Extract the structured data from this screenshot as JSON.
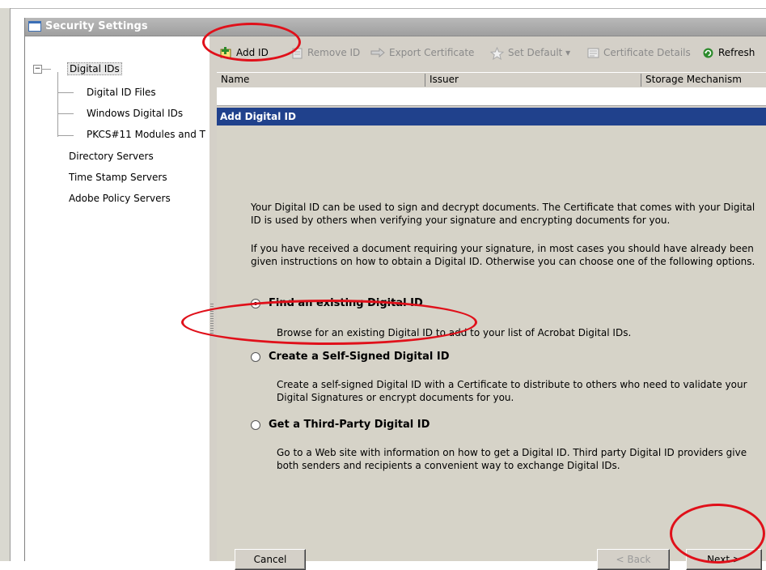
{
  "window": {
    "title": "Security Settings"
  },
  "tree": {
    "items": [
      {
        "label": "Digital IDs"
      },
      {
        "label": "Digital ID Files"
      },
      {
        "label": "Windows Digital IDs"
      },
      {
        "label": "PKCS#11 Modules and T"
      },
      {
        "label": "Directory Servers"
      },
      {
        "label": "Time Stamp Servers"
      },
      {
        "label": "Adobe Policy Servers"
      }
    ],
    "expander_glyph": "−"
  },
  "toolbar": {
    "add_id": "Add ID",
    "remove_id": "Remove ID",
    "export_certificate": "Export Certificate",
    "set_default": "Set Default ▾",
    "certificate_details": "Certificate Details",
    "refresh": "Refresh"
  },
  "columns": [
    "Name",
    "Issuer",
    "Storage Mechanism"
  ],
  "dialog": {
    "title": "Add Digital ID",
    "intro1": "Your Digital ID can be used to sign and decrypt documents. The Certificate that comes with your Digital ID is used by others when verifying your signature and encrypting documents for you.",
    "intro2": "If you have received a document requiring your signature, in most cases you should have already been given instructions on how to obtain a Digital ID. Otherwise you can choose one of the following options.",
    "options": [
      {
        "label": "Find an existing Digital ID",
        "desc": "Browse for an existing Digital ID to add to your list of Acrobat Digital IDs.",
        "checked": true
      },
      {
        "label": "Create a Self-Signed Digital ID",
        "desc": "Create a self-signed Digital ID with a Certificate to distribute to others who need to validate your Digital Signatures or encrypt documents for you.",
        "checked": false
      },
      {
        "label": "Get a Third-Party Digital ID",
        "desc": "Go to a Web site with information on how to get a Digital ID. Third party Digital ID providers give both senders and recipients a convenient way to exchange Digital IDs.",
        "checked": false
      }
    ],
    "cancel": "Cancel",
    "back": "< Back",
    "next": "Next >"
  },
  "colors": {
    "dialog_title_bg": "#20418c",
    "annotation": "#e0101a",
    "window_bg": "#d4d0c8"
  },
  "icons": [
    "add-id-icon",
    "remove-id-icon",
    "export-certificate-icon",
    "set-default-star-icon",
    "certificate-details-icon",
    "refresh-icon"
  ]
}
